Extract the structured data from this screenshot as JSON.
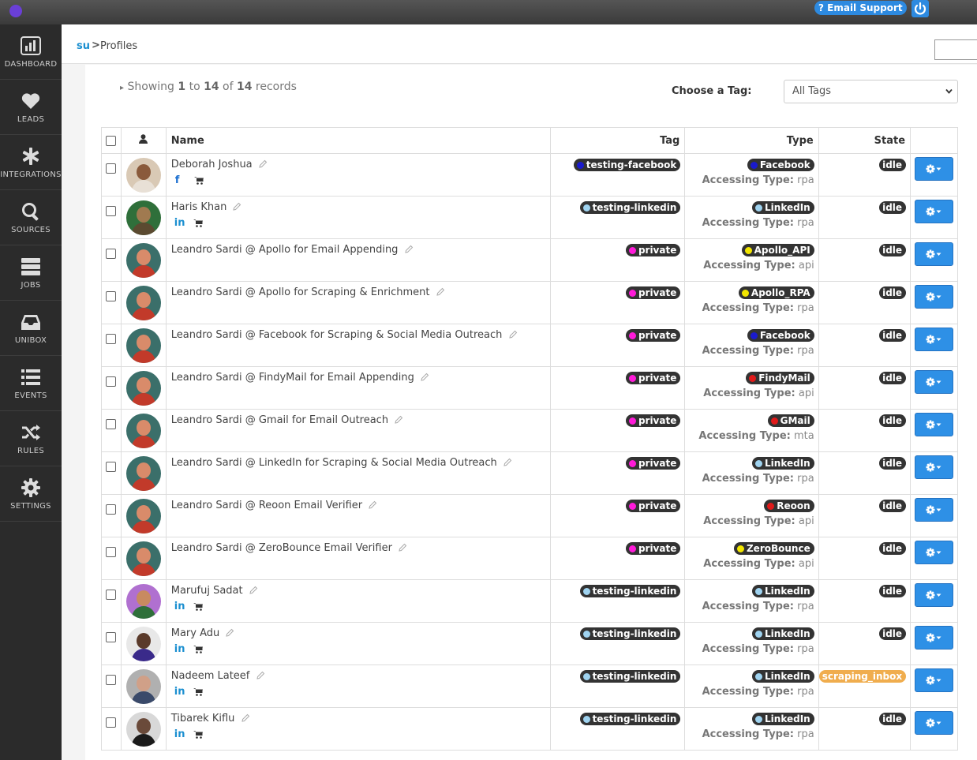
{
  "topbar": {
    "support_label": "? Email Support"
  },
  "sidebar": {
    "items": [
      {
        "label": "DASHBOARD",
        "icon": "bar-chart-icon"
      },
      {
        "label": "LEADS",
        "icon": "heart-icon"
      },
      {
        "label": "INTEGRATIONS",
        "icon": "asterisk-icon"
      },
      {
        "label": "SOURCES",
        "icon": "search-icon"
      },
      {
        "label": "JOBS",
        "icon": "server-icon"
      },
      {
        "label": "UNIBOX",
        "icon": "inbox-icon"
      },
      {
        "label": "EVENTS",
        "icon": "list-icon"
      },
      {
        "label": "RULES",
        "icon": "shuffle-icon"
      },
      {
        "label": "SETTINGS",
        "icon": "gear-icon"
      }
    ]
  },
  "breadcrumb": {
    "root": "su",
    "separator": ">",
    "page": "Profiles"
  },
  "summary": {
    "prefix": "Showing",
    "from": "1",
    "to_word": "to",
    "to": "14",
    "of_word": "of",
    "total": "14",
    "suffix": "records"
  },
  "tag_filter": {
    "label": "Choose a Tag:",
    "selected": "All Tags"
  },
  "table": {
    "headers": {
      "name": "Name",
      "tag": "Tag",
      "type": "Type",
      "state": "State"
    },
    "access_label": "Accessing Type:",
    "rows": [
      {
        "name": "Deborah Joshua",
        "social": "facebook",
        "tag": "testing-facebook",
        "tag_color": "#1a1acc",
        "type": "Facebook",
        "type_color": "#1a1acc",
        "access": "rpa",
        "state": "idle",
        "avatar": [
          "#d9c9b5",
          "#8a5a3b",
          "#e8e0d6"
        ]
      },
      {
        "name": "Haris Khan",
        "social": "linkedin",
        "tag": "testing-linkedin",
        "tag_color": "#9fd3f0",
        "type": "LinkedIn",
        "type_color": "#9fd3f0",
        "access": "rpa",
        "state": "idle",
        "avatar": [
          "#2f6f3a",
          "#a07a50",
          "#5b4a30"
        ]
      },
      {
        "name": "Leandro Sardi @ Apollo for Email Appending",
        "social": "",
        "tag": "private",
        "tag_color": "#ff1ad9",
        "type": "Apollo_API",
        "type_color": "#f2e600",
        "access": "api",
        "state": "idle",
        "avatar": [
          "#3b6f6a",
          "#d98b6a",
          "#c23a2a"
        ]
      },
      {
        "name": "Leandro Sardi @ Apollo for Scraping & Enrichment",
        "social": "",
        "tag": "private",
        "tag_color": "#ff1ad9",
        "type": "Apollo_RPA",
        "type_color": "#f2e600",
        "access": "rpa",
        "state": "idle",
        "avatar": [
          "#3b6f6a",
          "#d98b6a",
          "#c23a2a"
        ]
      },
      {
        "name": "Leandro Sardi @ Facebook for Scraping & Social Media Outreach",
        "social": "",
        "tag": "private",
        "tag_color": "#ff1ad9",
        "type": "Facebook",
        "type_color": "#1a1acc",
        "access": "rpa",
        "state": "idle",
        "avatar": [
          "#3b6f6a",
          "#d98b6a",
          "#c23a2a"
        ]
      },
      {
        "name": "Leandro Sardi @ FindyMail for Email Appending",
        "social": "",
        "tag": "private",
        "tag_color": "#ff1ad9",
        "type": "FindyMail",
        "type_color": "#e01a1a",
        "access": "api",
        "state": "idle",
        "avatar": [
          "#3b6f6a",
          "#d98b6a",
          "#c23a2a"
        ]
      },
      {
        "name": "Leandro Sardi @ Gmail for Email Outreach",
        "social": "",
        "tag": "private",
        "tag_color": "#ff1ad9",
        "type": "GMail",
        "type_color": "#e01a1a",
        "access": "mta",
        "state": "idle",
        "avatar": [
          "#3b6f6a",
          "#d98b6a",
          "#c23a2a"
        ]
      },
      {
        "name": "Leandro Sardi @ LinkedIn for Scraping & Social Media Outreach",
        "social": "",
        "tag": "private",
        "tag_color": "#ff1ad9",
        "type": "LinkedIn",
        "type_color": "#9fd3f0",
        "access": "rpa",
        "state": "idle",
        "avatar": [
          "#3b6f6a",
          "#d98b6a",
          "#c23a2a"
        ]
      },
      {
        "name": "Leandro Sardi @ Reoon Email Verifier",
        "social": "",
        "tag": "private",
        "tag_color": "#ff1ad9",
        "type": "Reoon",
        "type_color": "#e01a1a",
        "access": "api",
        "state": "idle",
        "avatar": [
          "#3b6f6a",
          "#d98b6a",
          "#c23a2a"
        ]
      },
      {
        "name": "Leandro Sardi @ ZeroBounce Email Verifier",
        "social": "",
        "tag": "private",
        "tag_color": "#ff1ad9",
        "type": "ZeroBounce",
        "type_color": "#f2e600",
        "access": "api",
        "state": "idle",
        "avatar": [
          "#3b6f6a",
          "#d98b6a",
          "#c23a2a"
        ]
      },
      {
        "name": "Marufuj Sadat",
        "social": "linkedin",
        "tag": "testing-linkedin",
        "tag_color": "#9fd3f0",
        "type": "LinkedIn",
        "type_color": "#9fd3f0",
        "access": "rpa",
        "state": "idle",
        "avatar": [
          "#b070d0",
          "#c88a60",
          "#2f6f3a"
        ]
      },
      {
        "name": "Mary Adu",
        "social": "linkedin",
        "tag": "testing-linkedin",
        "tag_color": "#9fd3f0",
        "type": "LinkedIn",
        "type_color": "#9fd3f0",
        "access": "rpa",
        "state": "idle",
        "avatar": [
          "#e8e8e8",
          "#5a3a2a",
          "#3a2a8a"
        ]
      },
      {
        "name": "Nadeem Lateef",
        "social": "linkedin",
        "tag": "testing-linkedin",
        "tag_color": "#9fd3f0",
        "type": "LinkedIn",
        "type_color": "#9fd3f0",
        "access": "rpa",
        "state": "scraping_inbox",
        "avatar": [
          "#b0b0b0",
          "#d0a088",
          "#3a4a6a"
        ]
      },
      {
        "name": "Tibarek Kiflu",
        "social": "linkedin",
        "tag": "testing-linkedin",
        "tag_color": "#9fd3f0",
        "type": "LinkedIn",
        "type_color": "#9fd3f0",
        "access": "rpa",
        "state": "idle",
        "avatar": [
          "#d8d8d8",
          "#6a4a3a",
          "#1a1a1a"
        ]
      }
    ]
  }
}
